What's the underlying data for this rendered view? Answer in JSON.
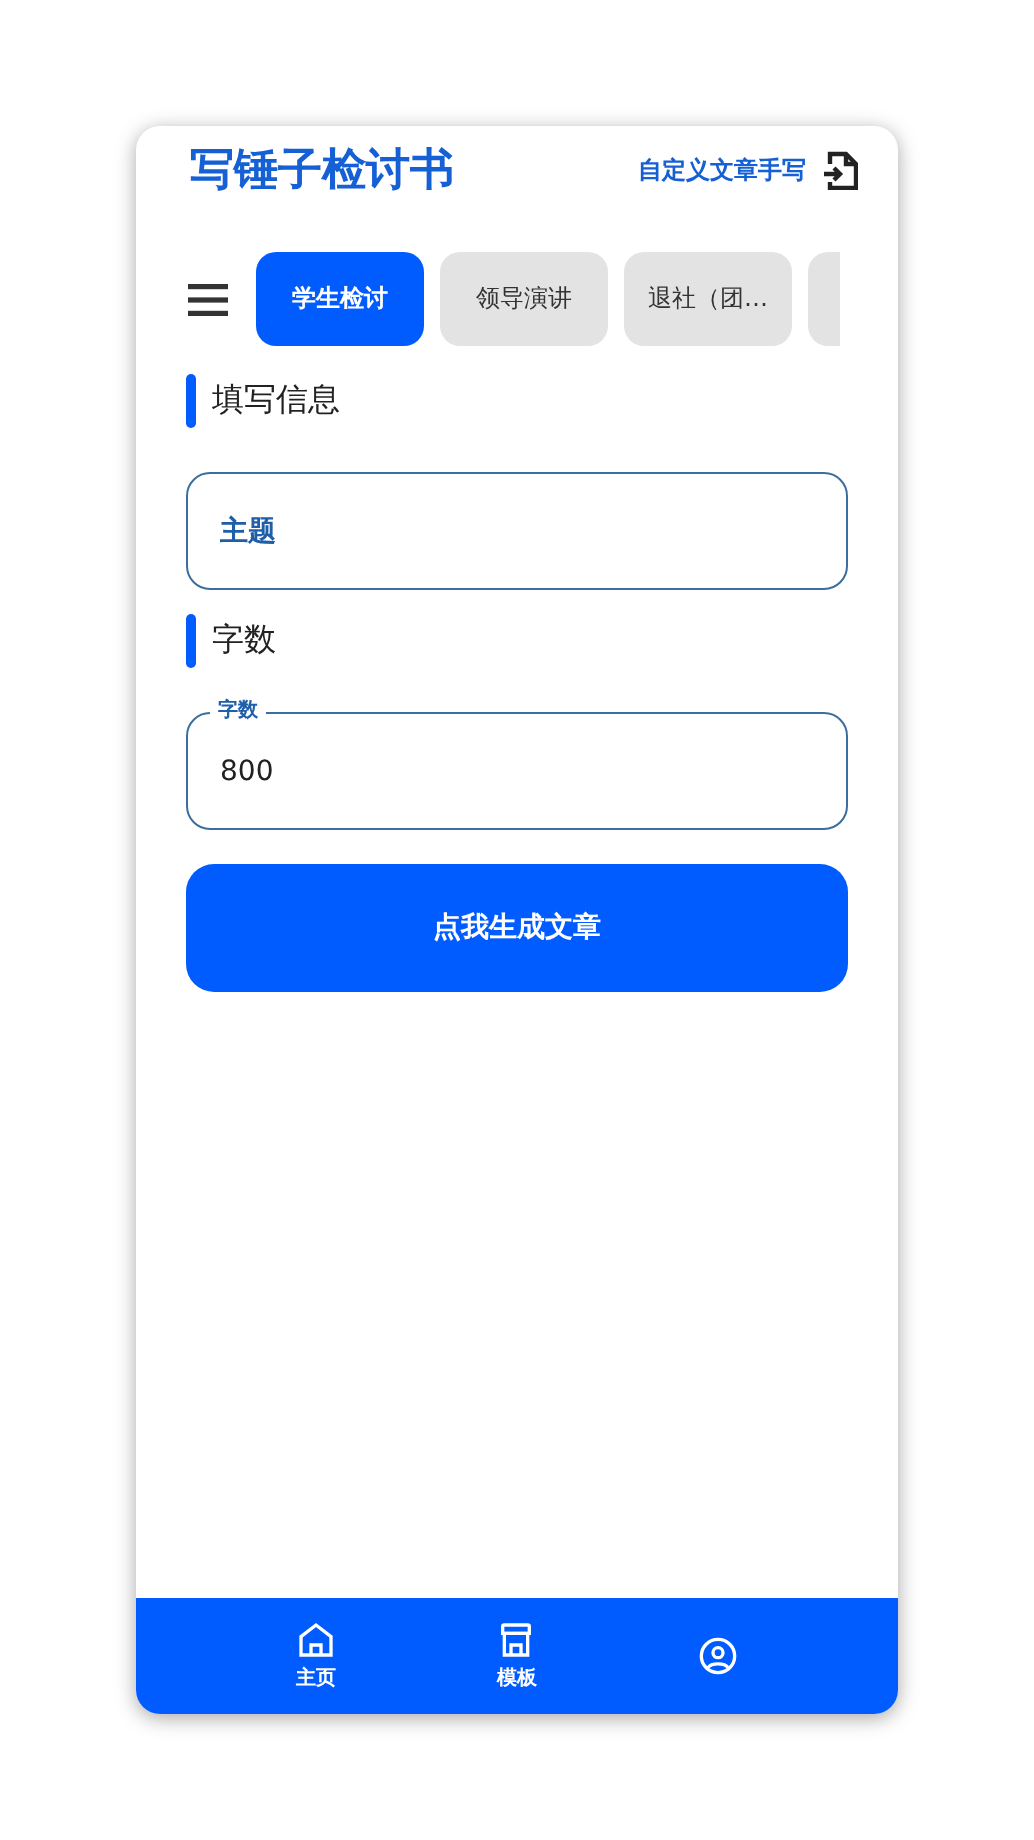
{
  "header": {
    "title": "写锤子检讨书",
    "action": "自定义文章手写"
  },
  "tabs": [
    {
      "label": "学生检讨",
      "selected": true
    },
    {
      "label": "领导演讲",
      "selected": false
    },
    {
      "label": "退社（团…",
      "selected": false
    },
    {
      "selected": false
    }
  ],
  "sections": [
    {
      "heading": "填写信息",
      "field": {
        "placeholder": "主题"
      }
    },
    {
      "heading": "字数",
      "field": {
        "label": "字数",
        "value": "800"
      }
    }
  ],
  "submit": "点我生成文章",
  "bottom_nav": [
    {
      "kind": "home",
      "label": "主页"
    },
    {
      "kind": "store",
      "label": "模板"
    },
    {
      "kind": "person"
    }
  ]
}
